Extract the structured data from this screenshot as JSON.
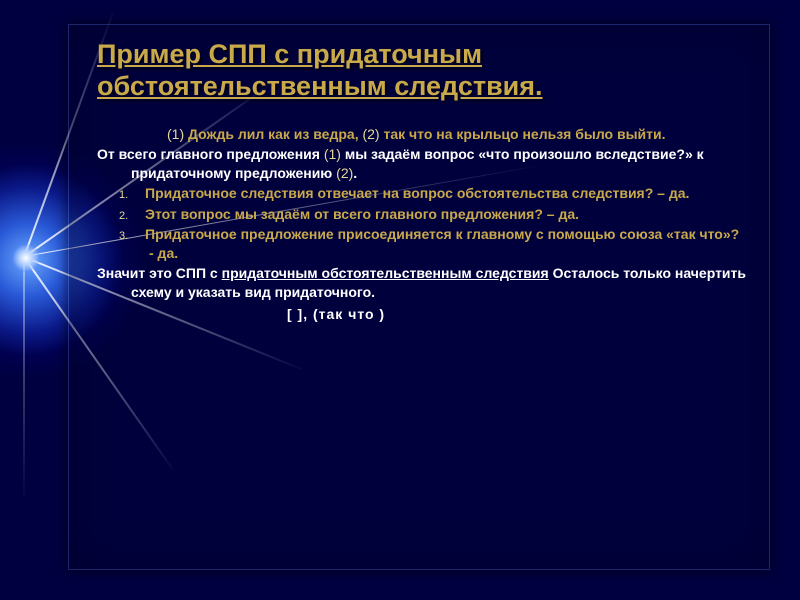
{
  "title": "Пример СПП  с придаточным обстоятельственным следствия.",
  "example": {
    "prefix_num1": "(1)",
    "part1": " Дождь лил как из ведра, ",
    "prefix_num2": "(2)",
    "part2": " так что на крыльцо нельзя было выйти."
  },
  "intro": {
    "a": "От всего главного предложения ",
    "n1": "(1)",
    "b": " мы задаём вопрос «что произошло вследствие?» к придаточному предложению ",
    "n2": "(2)",
    "c": "."
  },
  "list": [
    "Придаточное следствия отвечает на вопрос обстоятельства следствия? – да.",
    "Этот вопрос мы задаём от всего главного предложения? – да.",
    "Придаточное предложение присоединяется к главному с помощью союза «так что»? - да."
  ],
  "conclusion": {
    "a": "Значит это СПП с ",
    "b": "придаточным обстоятельственным следствия",
    "c": " Осталось только начертить схему и указать вид придаточного."
  },
  "schema": "[               ], (так что                 )"
}
